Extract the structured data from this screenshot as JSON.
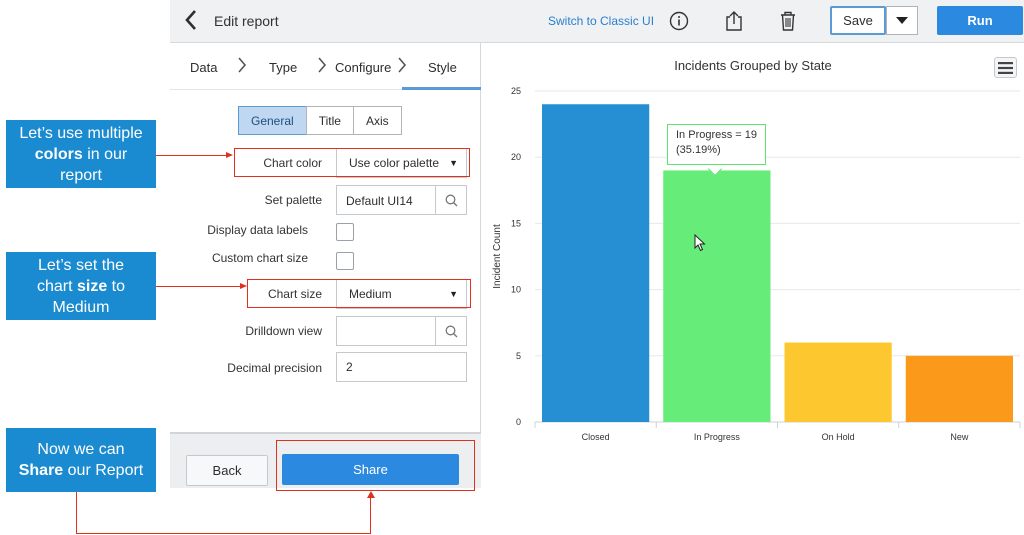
{
  "header": {
    "back_icon": "chevron-left-icon",
    "title": "Edit report",
    "switch_link": "Switch to Classic UI",
    "save_label": "Save",
    "run_label": "Run"
  },
  "steps": {
    "items": [
      "Data",
      "Type",
      "Configure",
      "Style"
    ],
    "active": "Style"
  },
  "style_tabs": {
    "items": [
      "General",
      "Title",
      "Axis"
    ],
    "active": "General"
  },
  "form": {
    "chart_color_label": "Chart color",
    "chart_color_value": "Use color palette",
    "set_palette_label": "Set palette",
    "set_palette_value": "Default UI14",
    "display_data_labels_label": "Display data labels",
    "custom_chart_size_label": "Custom chart size",
    "chart_size_label": "Chart size",
    "chart_size_value": "Medium",
    "drilldown_view_label": "Drilldown view",
    "drilldown_view_value": "",
    "decimal_precision_label": "Decimal precision",
    "decimal_precision_value": "2"
  },
  "footer": {
    "back_label": "Back",
    "share_label": "Share"
  },
  "callouts": {
    "colors": [
      "Let’s use multiple",
      "colors",
      " in our",
      "report"
    ],
    "size": [
      "Let’s set the",
      "chart ",
      "size",
      " to",
      "Medium"
    ],
    "share": [
      "Now we can",
      "Share",
      " our Report"
    ]
  },
  "tooltip": {
    "line1": "In Progress = 19",
    "line2": "(35.19%)"
  },
  "colors": {
    "accent": "#2b8ae0",
    "callout": "#1a8bd0",
    "annotation_red": "#e0301e"
  },
  "chart_data": {
    "type": "bar",
    "title": "Incidents Grouped by State",
    "xlabel": "",
    "ylabel": "Incident Count",
    "categories": [
      "Closed",
      "In Progress",
      "On Hold",
      "New"
    ],
    "values": [
      24,
      19,
      6,
      5
    ],
    "colors": [
      "#268fd4",
      "#66ed79",
      "#fdc82f",
      "#fb9a1a"
    ],
    "ylim": [
      0,
      25
    ],
    "yticks": [
      0,
      5,
      10,
      15,
      20,
      25
    ],
    "grid": true,
    "legend": "none"
  }
}
